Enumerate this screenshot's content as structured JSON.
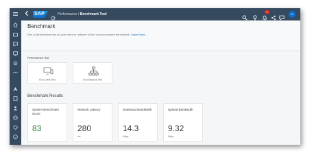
{
  "shell": {
    "logo_text": "SAP",
    "breadcrumb_parent": "Performance / ",
    "breadcrumb_current": "Benchmark Tool",
    "notification_count": "1",
    "avatar_initials": "IK",
    "shell_icons": [
      "search-icon",
      "lightbulb-icon",
      "bell-icon",
      "share-icon",
      "feedback-icon",
      "help-icon"
    ],
    "side_icons": [
      "menu-icon",
      "home-icon",
      "folder-icon",
      "chat-icon",
      "monitor-icon",
      "settings-icon",
      "more-icon",
      "deploy-icon",
      "document-icon",
      "people-icon",
      "globe-icon",
      "gear-icon",
      "help-icon"
    ]
  },
  "header": {
    "title": "Benchmark",
    "subtitle": "Run a performance test on your client or network to find out your system benchmark.",
    "learn_more": "Learn More..."
  },
  "performance_test": {
    "label": "Performance Test",
    "tiles": [
      {
        "caption": "Run Client Test",
        "icon": "monitor-icon"
      },
      {
        "caption": "Run Network Test",
        "icon": "network-icon"
      }
    ]
  },
  "results": {
    "title": "Benchmark Results",
    "metrics": [
      {
        "label": "System Benchmark Score",
        "value": "83",
        "unit": "",
        "status": "good"
      },
      {
        "label": "Network Latency",
        "value": "280",
        "unit": "ms",
        "status": "neutral"
      },
      {
        "label": "Download Bandwidth",
        "value": "14.3",
        "unit": "Mbps",
        "status": "neutral"
      },
      {
        "label": "Upload Bandwidth",
        "value": "9.32",
        "unit": "Mbps",
        "status": "neutral"
      }
    ]
  },
  "colors": {
    "shell_background": "#354a5f",
    "brand_blue": "#0a6ed1",
    "positive_green": "#2b7c2b",
    "badge_red": "#e52929"
  }
}
